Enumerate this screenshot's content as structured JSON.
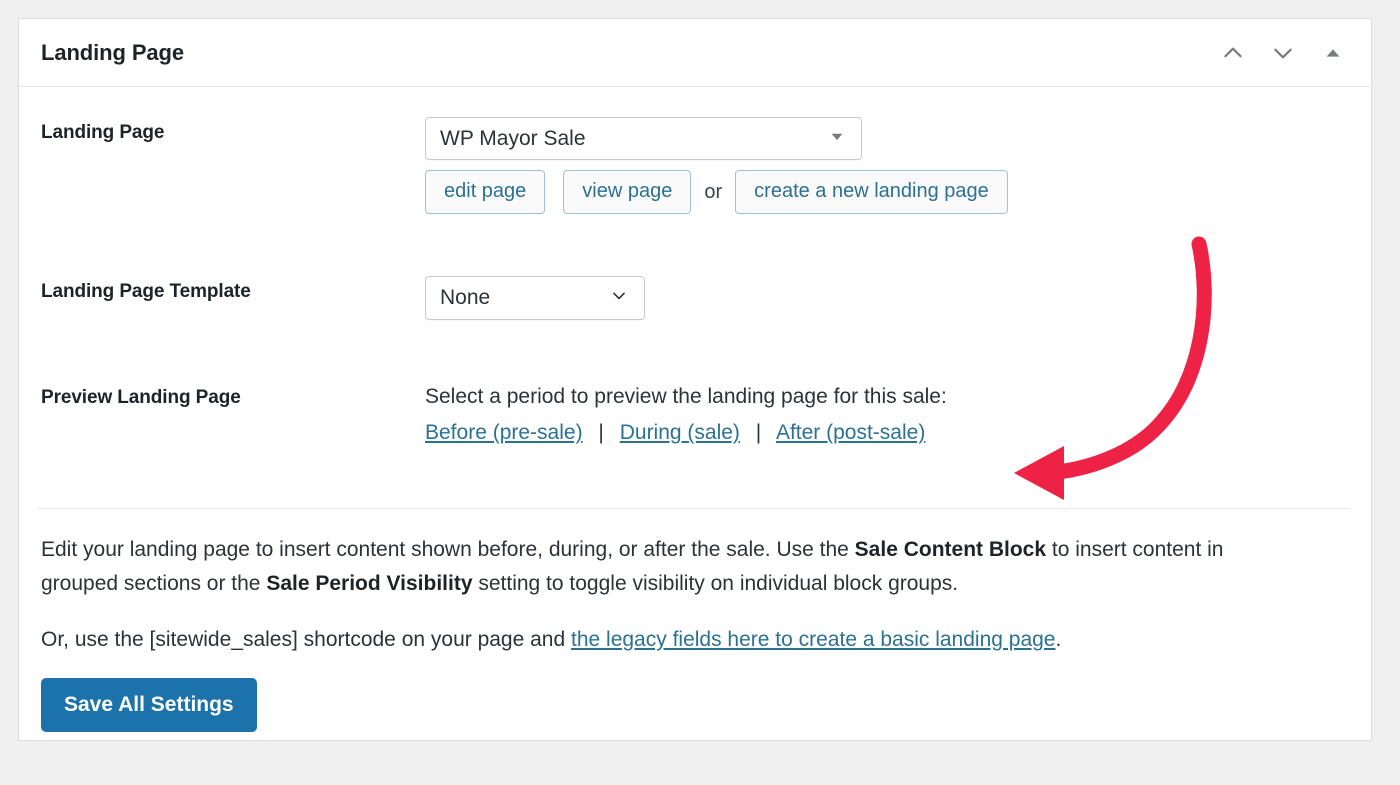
{
  "panel": {
    "title": "Landing Page",
    "header_controls": [
      {
        "name": "move-up-icon",
        "glyph": "chevron-up"
      },
      {
        "name": "move-down-icon",
        "glyph": "chevron-down"
      },
      {
        "name": "toggle-panel-icon",
        "glyph": "triangle-up"
      }
    ]
  },
  "rows": {
    "landing_page": {
      "label": "Landing Page",
      "select_value": "WP Mayor Sale",
      "buttons": {
        "edit": "edit page",
        "view": "view page",
        "or": "or",
        "create": "create a new landing page"
      }
    },
    "template": {
      "label": "Landing Page Template",
      "select_value": "None"
    },
    "preview": {
      "label": "Preview Landing Page",
      "intro": "Select a period to preview the landing page for this sale:",
      "links": [
        "Before (pre-sale)",
        "During (sale)",
        "After (post-sale)"
      ],
      "separator": "|"
    }
  },
  "footer": {
    "paragraph1": {
      "part1": "Edit your landing page to insert content shown before, during, or after the sale. Use the ",
      "bold1": "Sale Content Block",
      "part2": " to insert content in grouped sections or the ",
      "bold2": "Sale Period Visibility",
      "part3": " setting to toggle visibility on individual block groups."
    },
    "paragraph2": {
      "part1": "Or, use the [sitewide_sales] shortcode on your page and ",
      "link": "the legacy fields here to create a basic landing page",
      "part2": "."
    },
    "save_button": "Save All Settings"
  },
  "colors": {
    "accent_link": "#2a7193",
    "primary_button": "#1c72aa",
    "annotation_arrow": "#ee2244",
    "page_background": "#f0f0f1",
    "card_background": "#ffffff"
  },
  "annotation": {
    "name": "red-curved-arrow",
    "points_to": "After (post-sale)"
  }
}
